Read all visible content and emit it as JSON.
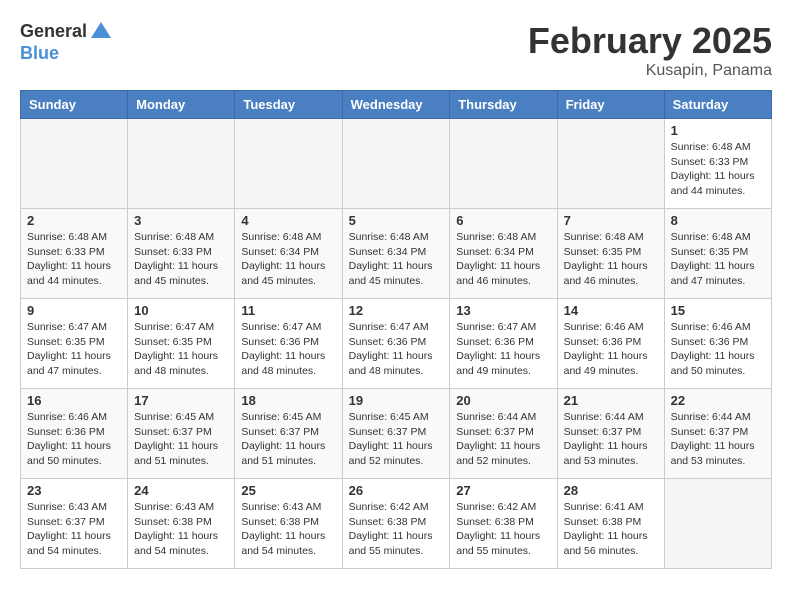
{
  "logo": {
    "general": "General",
    "blue": "Blue"
  },
  "header": {
    "title": "February 2025",
    "subtitle": "Kusapin, Panama"
  },
  "weekdays": [
    "Sunday",
    "Monday",
    "Tuesday",
    "Wednesday",
    "Thursday",
    "Friday",
    "Saturday"
  ],
  "weeks": [
    [
      {
        "day": "",
        "info": ""
      },
      {
        "day": "",
        "info": ""
      },
      {
        "day": "",
        "info": ""
      },
      {
        "day": "",
        "info": ""
      },
      {
        "day": "",
        "info": ""
      },
      {
        "day": "",
        "info": ""
      },
      {
        "day": "1",
        "info": "Sunrise: 6:48 AM\nSunset: 6:33 PM\nDaylight: 11 hours\nand 44 minutes."
      }
    ],
    [
      {
        "day": "2",
        "info": "Sunrise: 6:48 AM\nSunset: 6:33 PM\nDaylight: 11 hours\nand 44 minutes."
      },
      {
        "day": "3",
        "info": "Sunrise: 6:48 AM\nSunset: 6:33 PM\nDaylight: 11 hours\nand 45 minutes."
      },
      {
        "day": "4",
        "info": "Sunrise: 6:48 AM\nSunset: 6:34 PM\nDaylight: 11 hours\nand 45 minutes."
      },
      {
        "day": "5",
        "info": "Sunrise: 6:48 AM\nSunset: 6:34 PM\nDaylight: 11 hours\nand 45 minutes."
      },
      {
        "day": "6",
        "info": "Sunrise: 6:48 AM\nSunset: 6:34 PM\nDaylight: 11 hours\nand 46 minutes."
      },
      {
        "day": "7",
        "info": "Sunrise: 6:48 AM\nSunset: 6:35 PM\nDaylight: 11 hours\nand 46 minutes."
      },
      {
        "day": "8",
        "info": "Sunrise: 6:48 AM\nSunset: 6:35 PM\nDaylight: 11 hours\nand 47 minutes."
      }
    ],
    [
      {
        "day": "9",
        "info": "Sunrise: 6:47 AM\nSunset: 6:35 PM\nDaylight: 11 hours\nand 47 minutes."
      },
      {
        "day": "10",
        "info": "Sunrise: 6:47 AM\nSunset: 6:35 PM\nDaylight: 11 hours\nand 48 minutes."
      },
      {
        "day": "11",
        "info": "Sunrise: 6:47 AM\nSunset: 6:36 PM\nDaylight: 11 hours\nand 48 minutes."
      },
      {
        "day": "12",
        "info": "Sunrise: 6:47 AM\nSunset: 6:36 PM\nDaylight: 11 hours\nand 48 minutes."
      },
      {
        "day": "13",
        "info": "Sunrise: 6:47 AM\nSunset: 6:36 PM\nDaylight: 11 hours\nand 49 minutes."
      },
      {
        "day": "14",
        "info": "Sunrise: 6:46 AM\nSunset: 6:36 PM\nDaylight: 11 hours\nand 49 minutes."
      },
      {
        "day": "15",
        "info": "Sunrise: 6:46 AM\nSunset: 6:36 PM\nDaylight: 11 hours\nand 50 minutes."
      }
    ],
    [
      {
        "day": "16",
        "info": "Sunrise: 6:46 AM\nSunset: 6:36 PM\nDaylight: 11 hours\nand 50 minutes."
      },
      {
        "day": "17",
        "info": "Sunrise: 6:45 AM\nSunset: 6:37 PM\nDaylight: 11 hours\nand 51 minutes."
      },
      {
        "day": "18",
        "info": "Sunrise: 6:45 AM\nSunset: 6:37 PM\nDaylight: 11 hours\nand 51 minutes."
      },
      {
        "day": "19",
        "info": "Sunrise: 6:45 AM\nSunset: 6:37 PM\nDaylight: 11 hours\nand 52 minutes."
      },
      {
        "day": "20",
        "info": "Sunrise: 6:44 AM\nSunset: 6:37 PM\nDaylight: 11 hours\nand 52 minutes."
      },
      {
        "day": "21",
        "info": "Sunrise: 6:44 AM\nSunset: 6:37 PM\nDaylight: 11 hours\nand 53 minutes."
      },
      {
        "day": "22",
        "info": "Sunrise: 6:44 AM\nSunset: 6:37 PM\nDaylight: 11 hours\nand 53 minutes."
      }
    ],
    [
      {
        "day": "23",
        "info": "Sunrise: 6:43 AM\nSunset: 6:37 PM\nDaylight: 11 hours\nand 54 minutes."
      },
      {
        "day": "24",
        "info": "Sunrise: 6:43 AM\nSunset: 6:38 PM\nDaylight: 11 hours\nand 54 minutes."
      },
      {
        "day": "25",
        "info": "Sunrise: 6:43 AM\nSunset: 6:38 PM\nDaylight: 11 hours\nand 54 minutes."
      },
      {
        "day": "26",
        "info": "Sunrise: 6:42 AM\nSunset: 6:38 PM\nDaylight: 11 hours\nand 55 minutes."
      },
      {
        "day": "27",
        "info": "Sunrise: 6:42 AM\nSunset: 6:38 PM\nDaylight: 11 hours\nand 55 minutes."
      },
      {
        "day": "28",
        "info": "Sunrise: 6:41 AM\nSunset: 6:38 PM\nDaylight: 11 hours\nand 56 minutes."
      },
      {
        "day": "",
        "info": ""
      }
    ]
  ]
}
